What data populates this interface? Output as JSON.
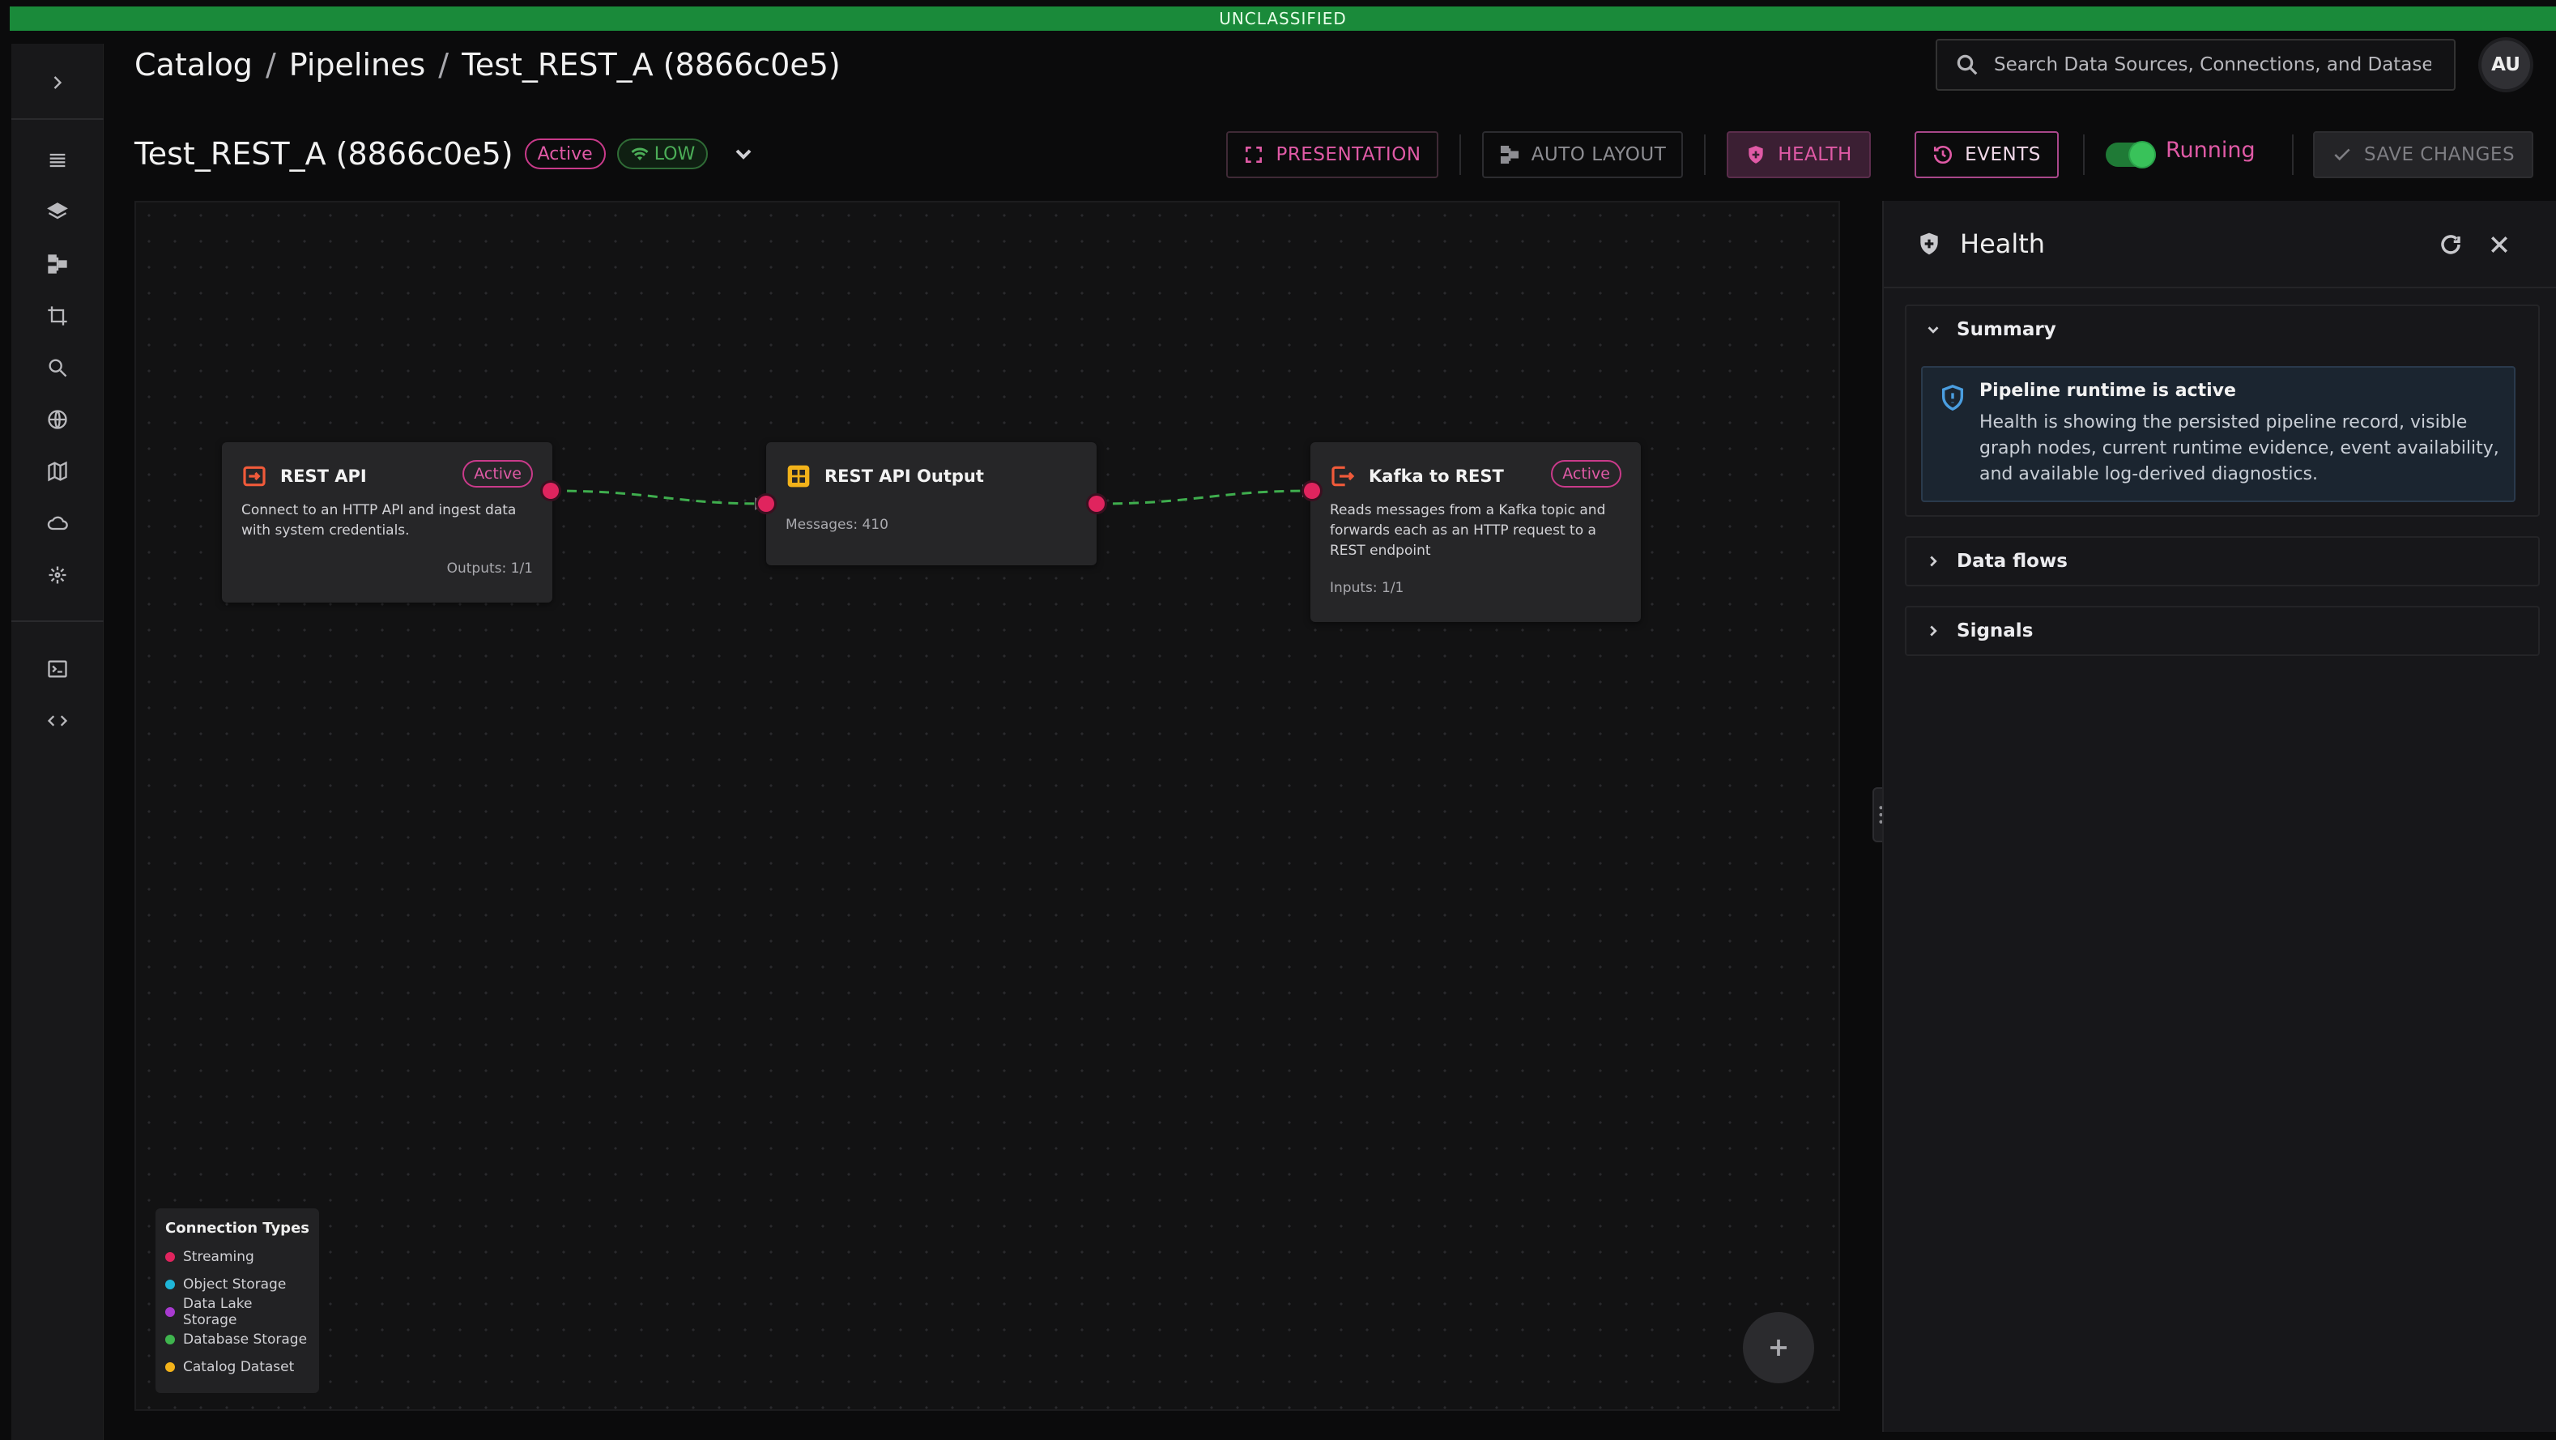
{
  "banner": "UNCLASSIFIED",
  "breadcrumb": {
    "items": [
      "Catalog",
      "Pipelines",
      "Test_REST_A (8866c0e5)"
    ],
    "separator": "/"
  },
  "search": {
    "placeholder": "Search Data Sources, Connections, and Datasets"
  },
  "user": {
    "initials": "AU"
  },
  "pipeline": {
    "title": "Test_REST_A (8866c0e5)",
    "status_badge": "Active",
    "priority_badge": "LOW"
  },
  "toolbar": {
    "presentation": "PRESENTATION",
    "auto_layout": "AUTO LAYOUT",
    "health": "HEALTH",
    "events": "EVENTS",
    "running_label": "Running",
    "running_on": true,
    "save": "SAVE CHANGES"
  },
  "sidebar": {
    "icons": [
      "expand-icon",
      "list-icon",
      "layers-icon",
      "hierarchy-icon",
      "crop-icon",
      "search-icon",
      "globe-icon",
      "map-icon",
      "cloud-icon",
      "network-icon",
      "terminal-icon",
      "code-icon"
    ]
  },
  "nodes": [
    {
      "title": "REST API",
      "badge": "Active",
      "description_lines": [
        "Connect to an HTTP API and ingest data",
        "with system credentials."
      ],
      "meta": "Outputs: 1/1",
      "icon": "input-arrow-icon"
    },
    {
      "title": "REST API Output",
      "badge": "",
      "description_lines": [],
      "meta": "Messages: 410",
      "icon": "grid-icon"
    },
    {
      "title": "Kafka to REST",
      "badge": "Active",
      "description_lines": [
        "Reads messages from a Kafka topic and",
        "forwards each as an HTTP request to a",
        "REST endpoint"
      ],
      "meta": "Inputs: 1/1",
      "icon": "output-arrow-icon"
    }
  ],
  "legend": {
    "title": "Connection Types",
    "items": [
      {
        "label": "Streaming",
        "color": "#e0245e"
      },
      {
        "label": "Object Storage",
        "color": "#1fb6d8"
      },
      {
        "label": "Data Lake Storage",
        "color": "#a83ad0"
      },
      {
        "label": "Database Storage",
        "color": "#3fb54e"
      },
      {
        "label": "Catalog Dataset",
        "color": "#f2b21a"
      }
    ]
  },
  "health_panel": {
    "title": "Health",
    "sections": {
      "summary": "Summary",
      "data_flows": "Data flows",
      "signals": "Signals"
    },
    "alert": {
      "title": "Pipeline runtime is active",
      "body": "Health is showing the persisted pipeline record, visible graph nodes, current runtime evidence, event availability, and available log-derived diagnostics."
    }
  },
  "colors": {
    "accent": "#e05aa6",
    "banner": "#1a8a3a",
    "edge": "#3fae4e",
    "port": "#e0245e",
    "info": "#4a9ee0"
  }
}
